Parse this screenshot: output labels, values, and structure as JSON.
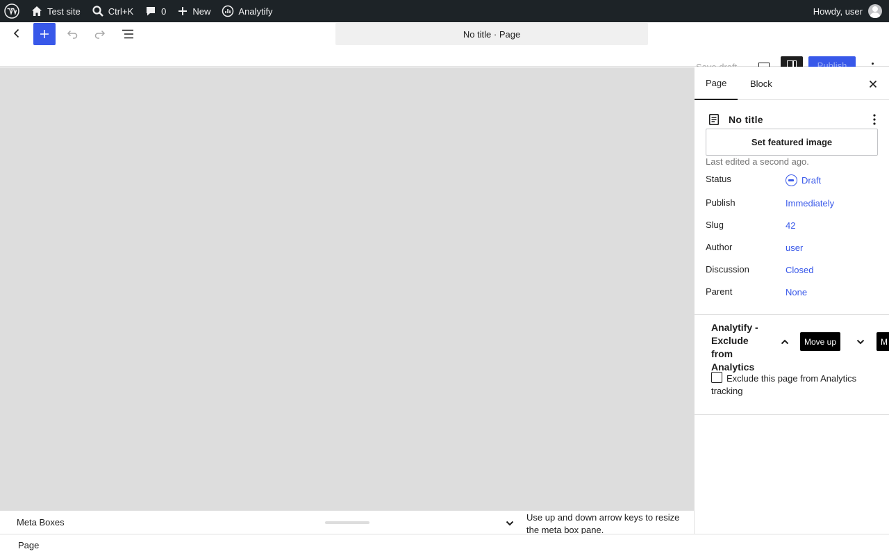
{
  "adminbar": {
    "site_name": "Test site",
    "search_shortcut": "Ctrl+K",
    "comments_count": "0",
    "new_label": "New",
    "analytify_label": "Analytify",
    "greeting": "Howdy, user"
  },
  "header": {
    "document_title": "No title · Page",
    "save_draft_label": "Save draft",
    "publish_label": "Publish"
  },
  "sidebar": {
    "tabs": [
      "Page",
      "Block"
    ],
    "panel_title": "No title",
    "featured_image_label": "Set featured image",
    "last_edited": "Last edited a second ago.",
    "rows": [
      {
        "label": "Status",
        "value": "Draft"
      },
      {
        "label": "Publish",
        "value": "Immediately"
      },
      {
        "label": "Slug",
        "value": "42"
      },
      {
        "label": "Author",
        "value": "user"
      },
      {
        "label": "Discussion",
        "value": "Closed"
      },
      {
        "label": "Parent",
        "value": "None"
      }
    ],
    "metabox": {
      "title": "Analytify - Exclude from Analytics",
      "move_up_tooltip": "Move up",
      "move_down_tooltip": "M",
      "checkbox_label": "Exclude this page from Analytics tracking",
      "checked": false
    }
  },
  "meta_pane": {
    "title": "Meta Boxes",
    "help_text": "Use up and down arrow keys to resize the meta box pane."
  },
  "footer": {
    "breadcrumb": "Page"
  },
  "colors": {
    "accent": "#3858e9",
    "adminbar_bg": "#1d2327",
    "canvas_bg": "#dddddd"
  }
}
